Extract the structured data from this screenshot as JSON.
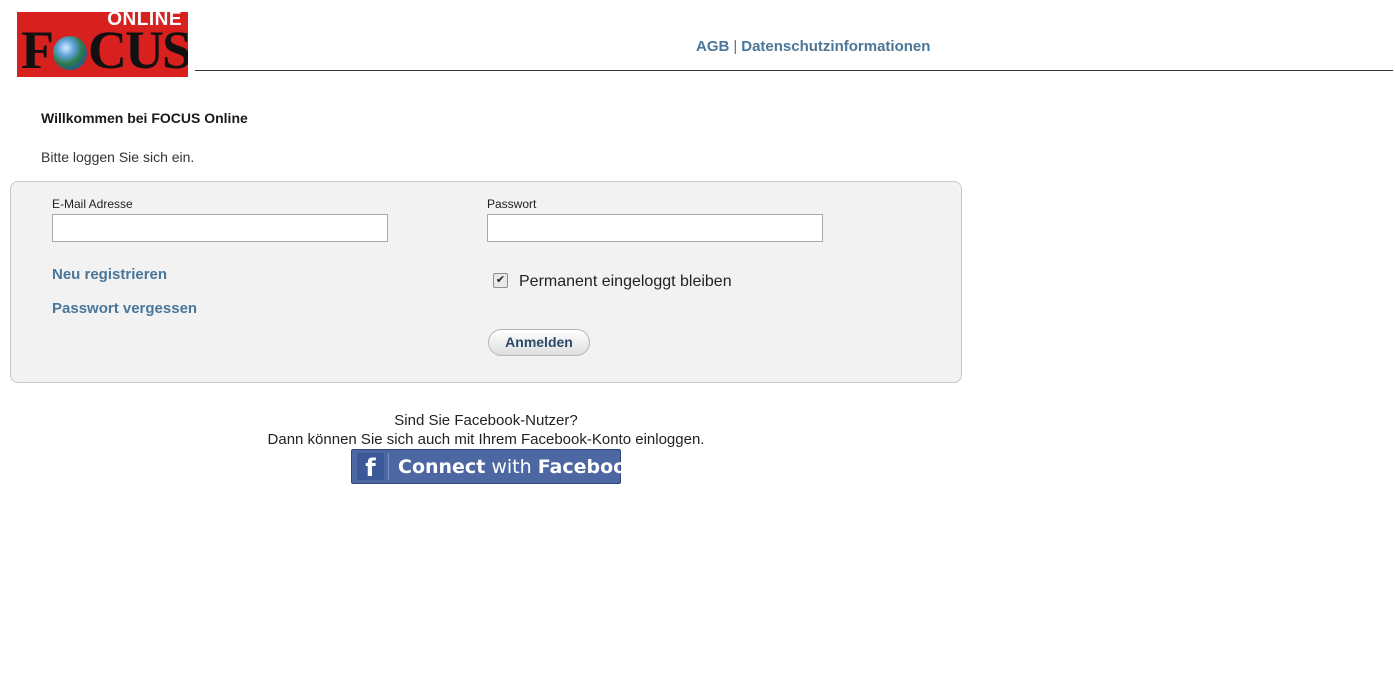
{
  "header": {
    "logo_top": "ONLINE",
    "logo_main_1": "F",
    "logo_main_2": "CUS",
    "links": {
      "agb": "AGB",
      "separator": "|",
      "privacy": "Datenschutzinformationen"
    }
  },
  "intro": {
    "welcome": "Willkommen bei FOCUS Online",
    "prompt": "Bitte loggen Sie sich ein."
  },
  "login": {
    "email_label": "E-Mail Adresse",
    "email_value": "",
    "password_label": "Passwort",
    "password_value": "",
    "register_link": "Neu registrieren",
    "forgot_link": "Passwort vergessen",
    "remember_label": "Permanent eingeloggt bleiben",
    "remember_checked": true,
    "submit_label": "Anmelden"
  },
  "facebook": {
    "question": "Sind Sie Facebook-Nutzer?",
    "info": "Dann können Sie sich auch mit Ihrem Facebook-Konto einloggen.",
    "button_connect": "Connect",
    "button_with": "with",
    "button_facebook": "Facebook",
    "icon_glyph": "f"
  },
  "colors": {
    "brand_red": "#d8201f",
    "link_blue": "#4a7699",
    "facebook_blue": "#4c67a1"
  }
}
